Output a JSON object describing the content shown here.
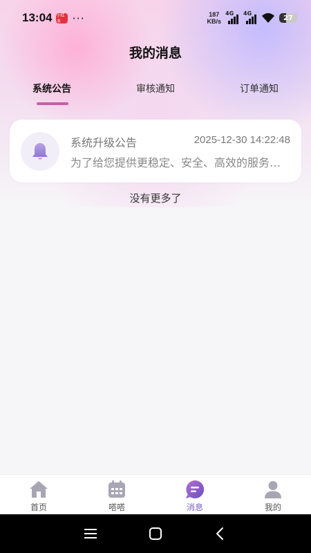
{
  "status": {
    "time": "13:04",
    "app_badge": "小红书",
    "dots": "···",
    "speed_value": "187",
    "speed_unit": "KB/s",
    "sim1": "4G",
    "sim2": "4G",
    "battery": "27"
  },
  "header": {
    "title": "我的消息"
  },
  "tabs": [
    {
      "label": "系统公告",
      "active": true
    },
    {
      "label": "审核通知",
      "active": false
    },
    {
      "label": "订单通知",
      "active": false
    }
  ],
  "messages": [
    {
      "icon": "bell-icon",
      "title": "系统升级公告",
      "time": "2025-12-30 14:22:48",
      "body": "为了给您提供更稳定、安全、高效的服务，我们将进行系统升级"
    }
  ],
  "list_end_text": "没有更多了",
  "bottom_nav": [
    {
      "label": "首页",
      "icon": "home-icon",
      "active": false
    },
    {
      "label": "嗒嗒",
      "icon": "calendar-icon",
      "active": false
    },
    {
      "label": "消息",
      "icon": "message-icon",
      "active": true
    },
    {
      "label": "我的",
      "icon": "user-icon",
      "active": false
    }
  ],
  "system_nav": [
    "menu-icon",
    "home-square-icon",
    "back-icon"
  ],
  "colors": {
    "accent": "#c45fa8",
    "nav_active": "#7a5fc0",
    "icon_gray": "#a8a5b4"
  }
}
